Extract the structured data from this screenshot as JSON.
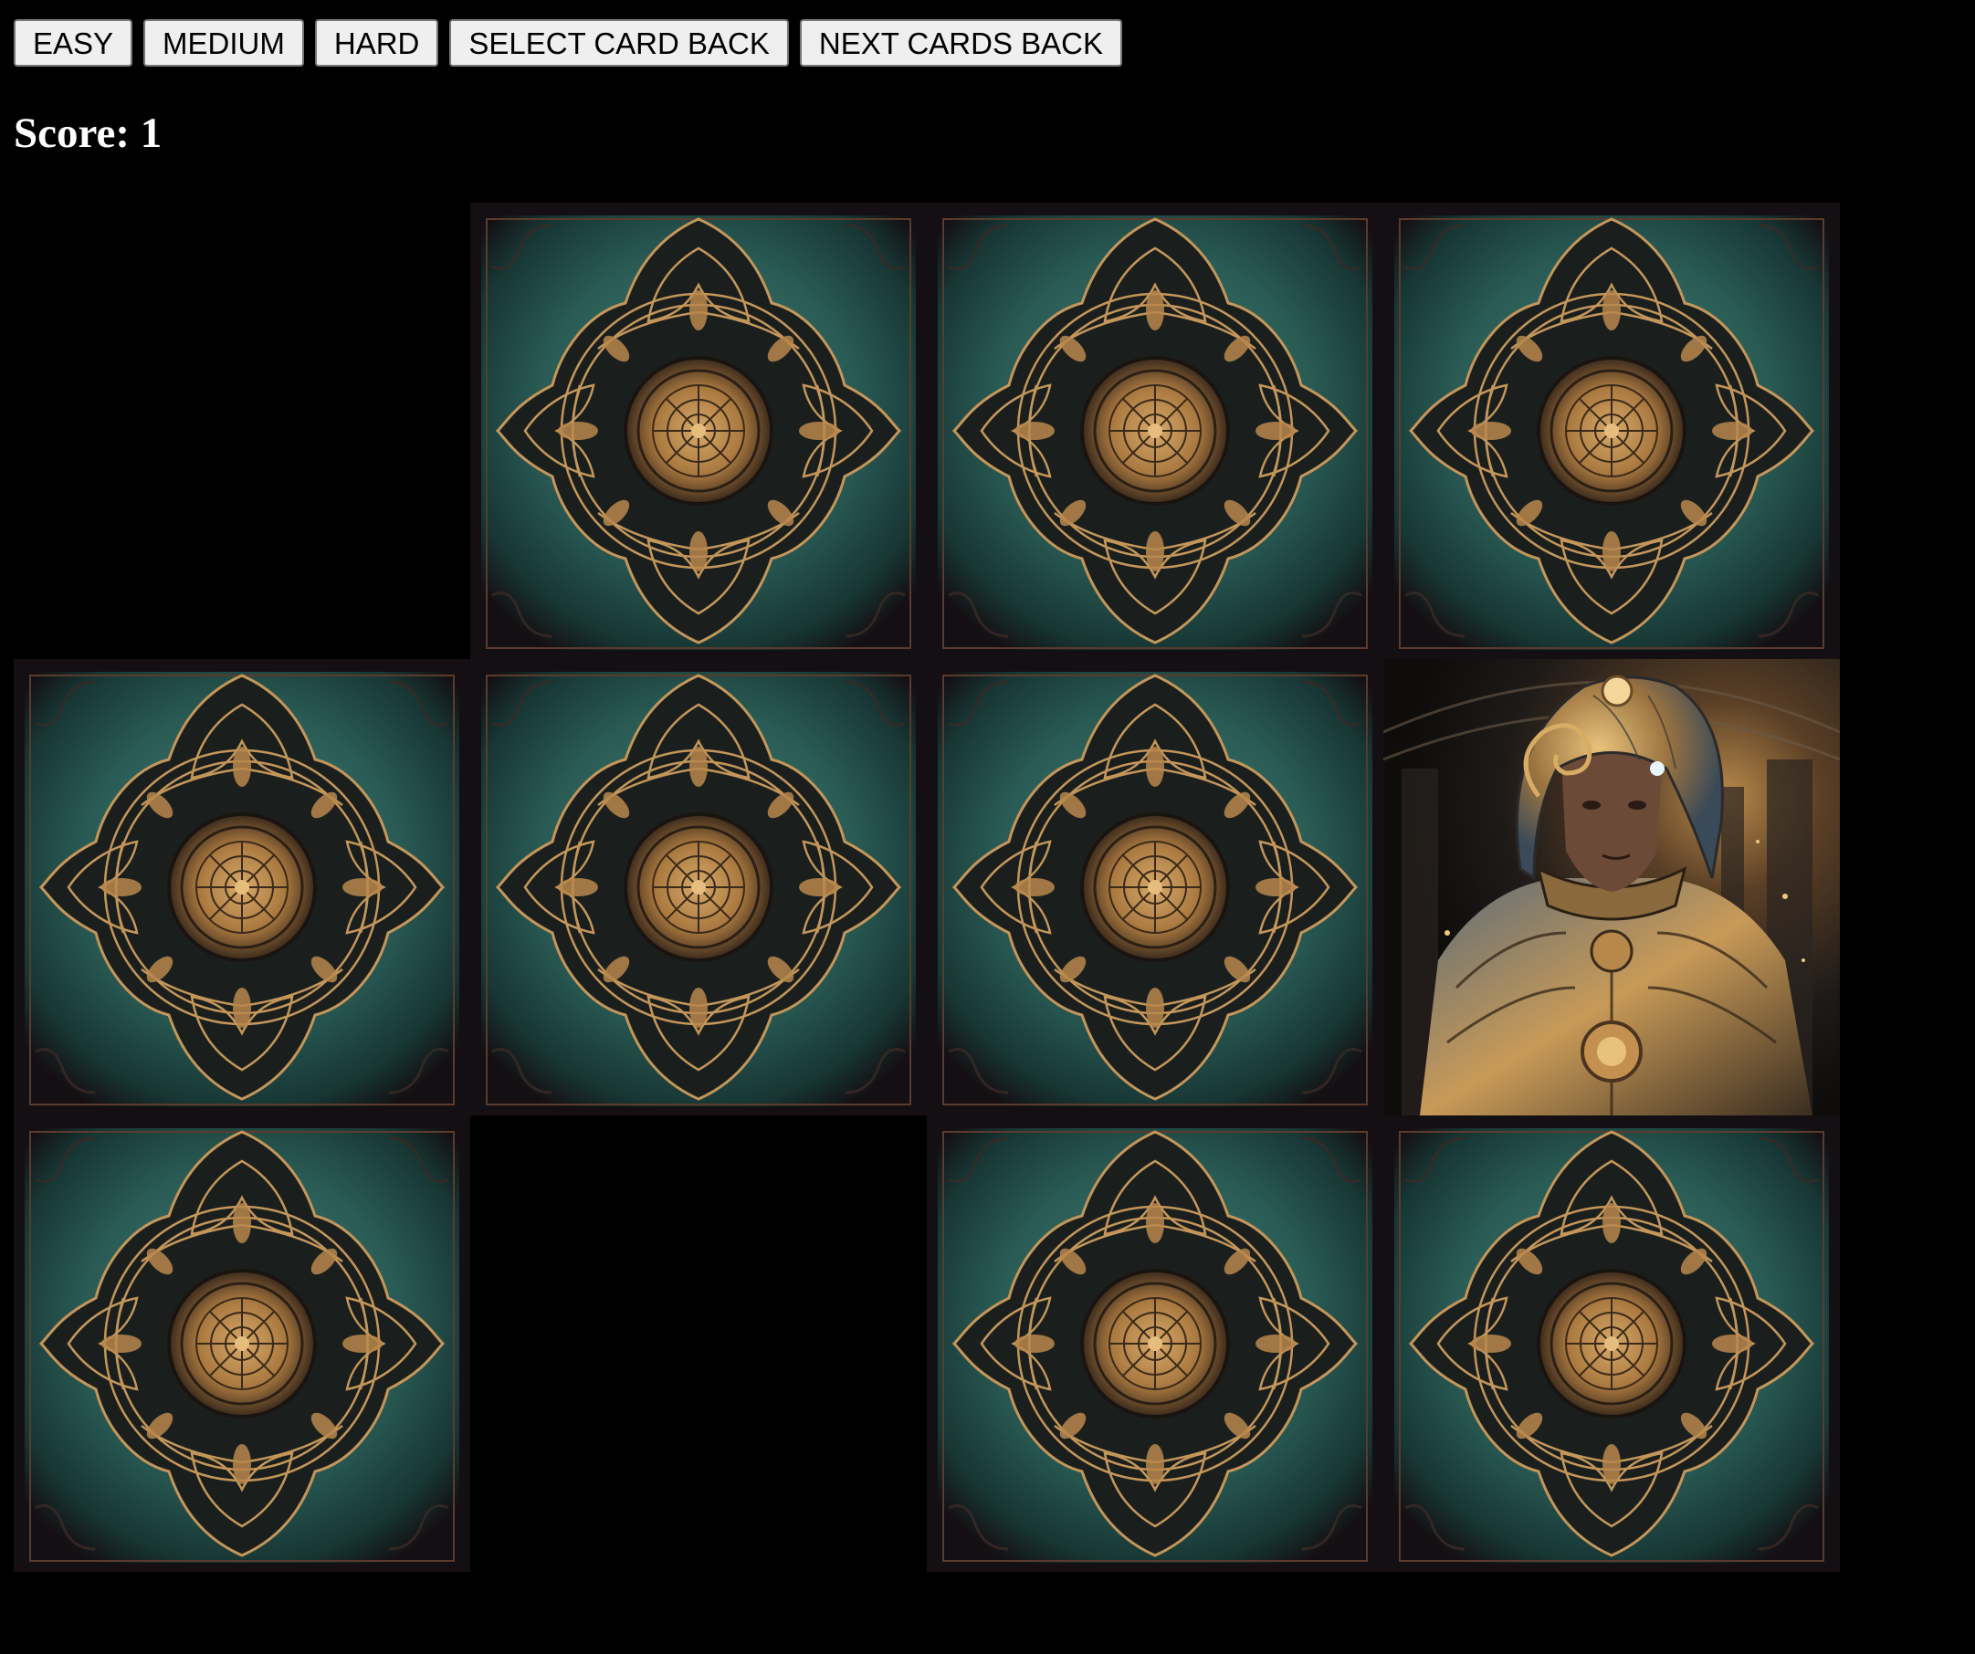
{
  "toolbar": {
    "easy_label": "EASY",
    "medium_label": "MEDIUM",
    "hard_label": "HARD",
    "select_back_label": "SELECT CARD BACK",
    "next_back_label": "NEXT CARDS BACK"
  },
  "score": {
    "text": "Score: 1"
  },
  "board": {
    "columns": 4,
    "rows": 3,
    "cells": [
      {
        "state": "removed"
      },
      {
        "state": "back"
      },
      {
        "state": "back"
      },
      {
        "state": "back"
      },
      {
        "state": "back"
      },
      {
        "state": "back"
      },
      {
        "state": "back"
      },
      {
        "state": "face"
      },
      {
        "state": "back"
      },
      {
        "state": "removed"
      },
      {
        "state": "back"
      },
      {
        "state": "back"
      }
    ]
  },
  "colors": {
    "background": "#000000",
    "card_teal": "#2c6058",
    "card_dark": "#140f12",
    "ornament_gold": "#c4965a"
  },
  "icons": {
    "card_back": "mandala-ornament-icon",
    "card_face": "armored-warrior-portrait"
  }
}
